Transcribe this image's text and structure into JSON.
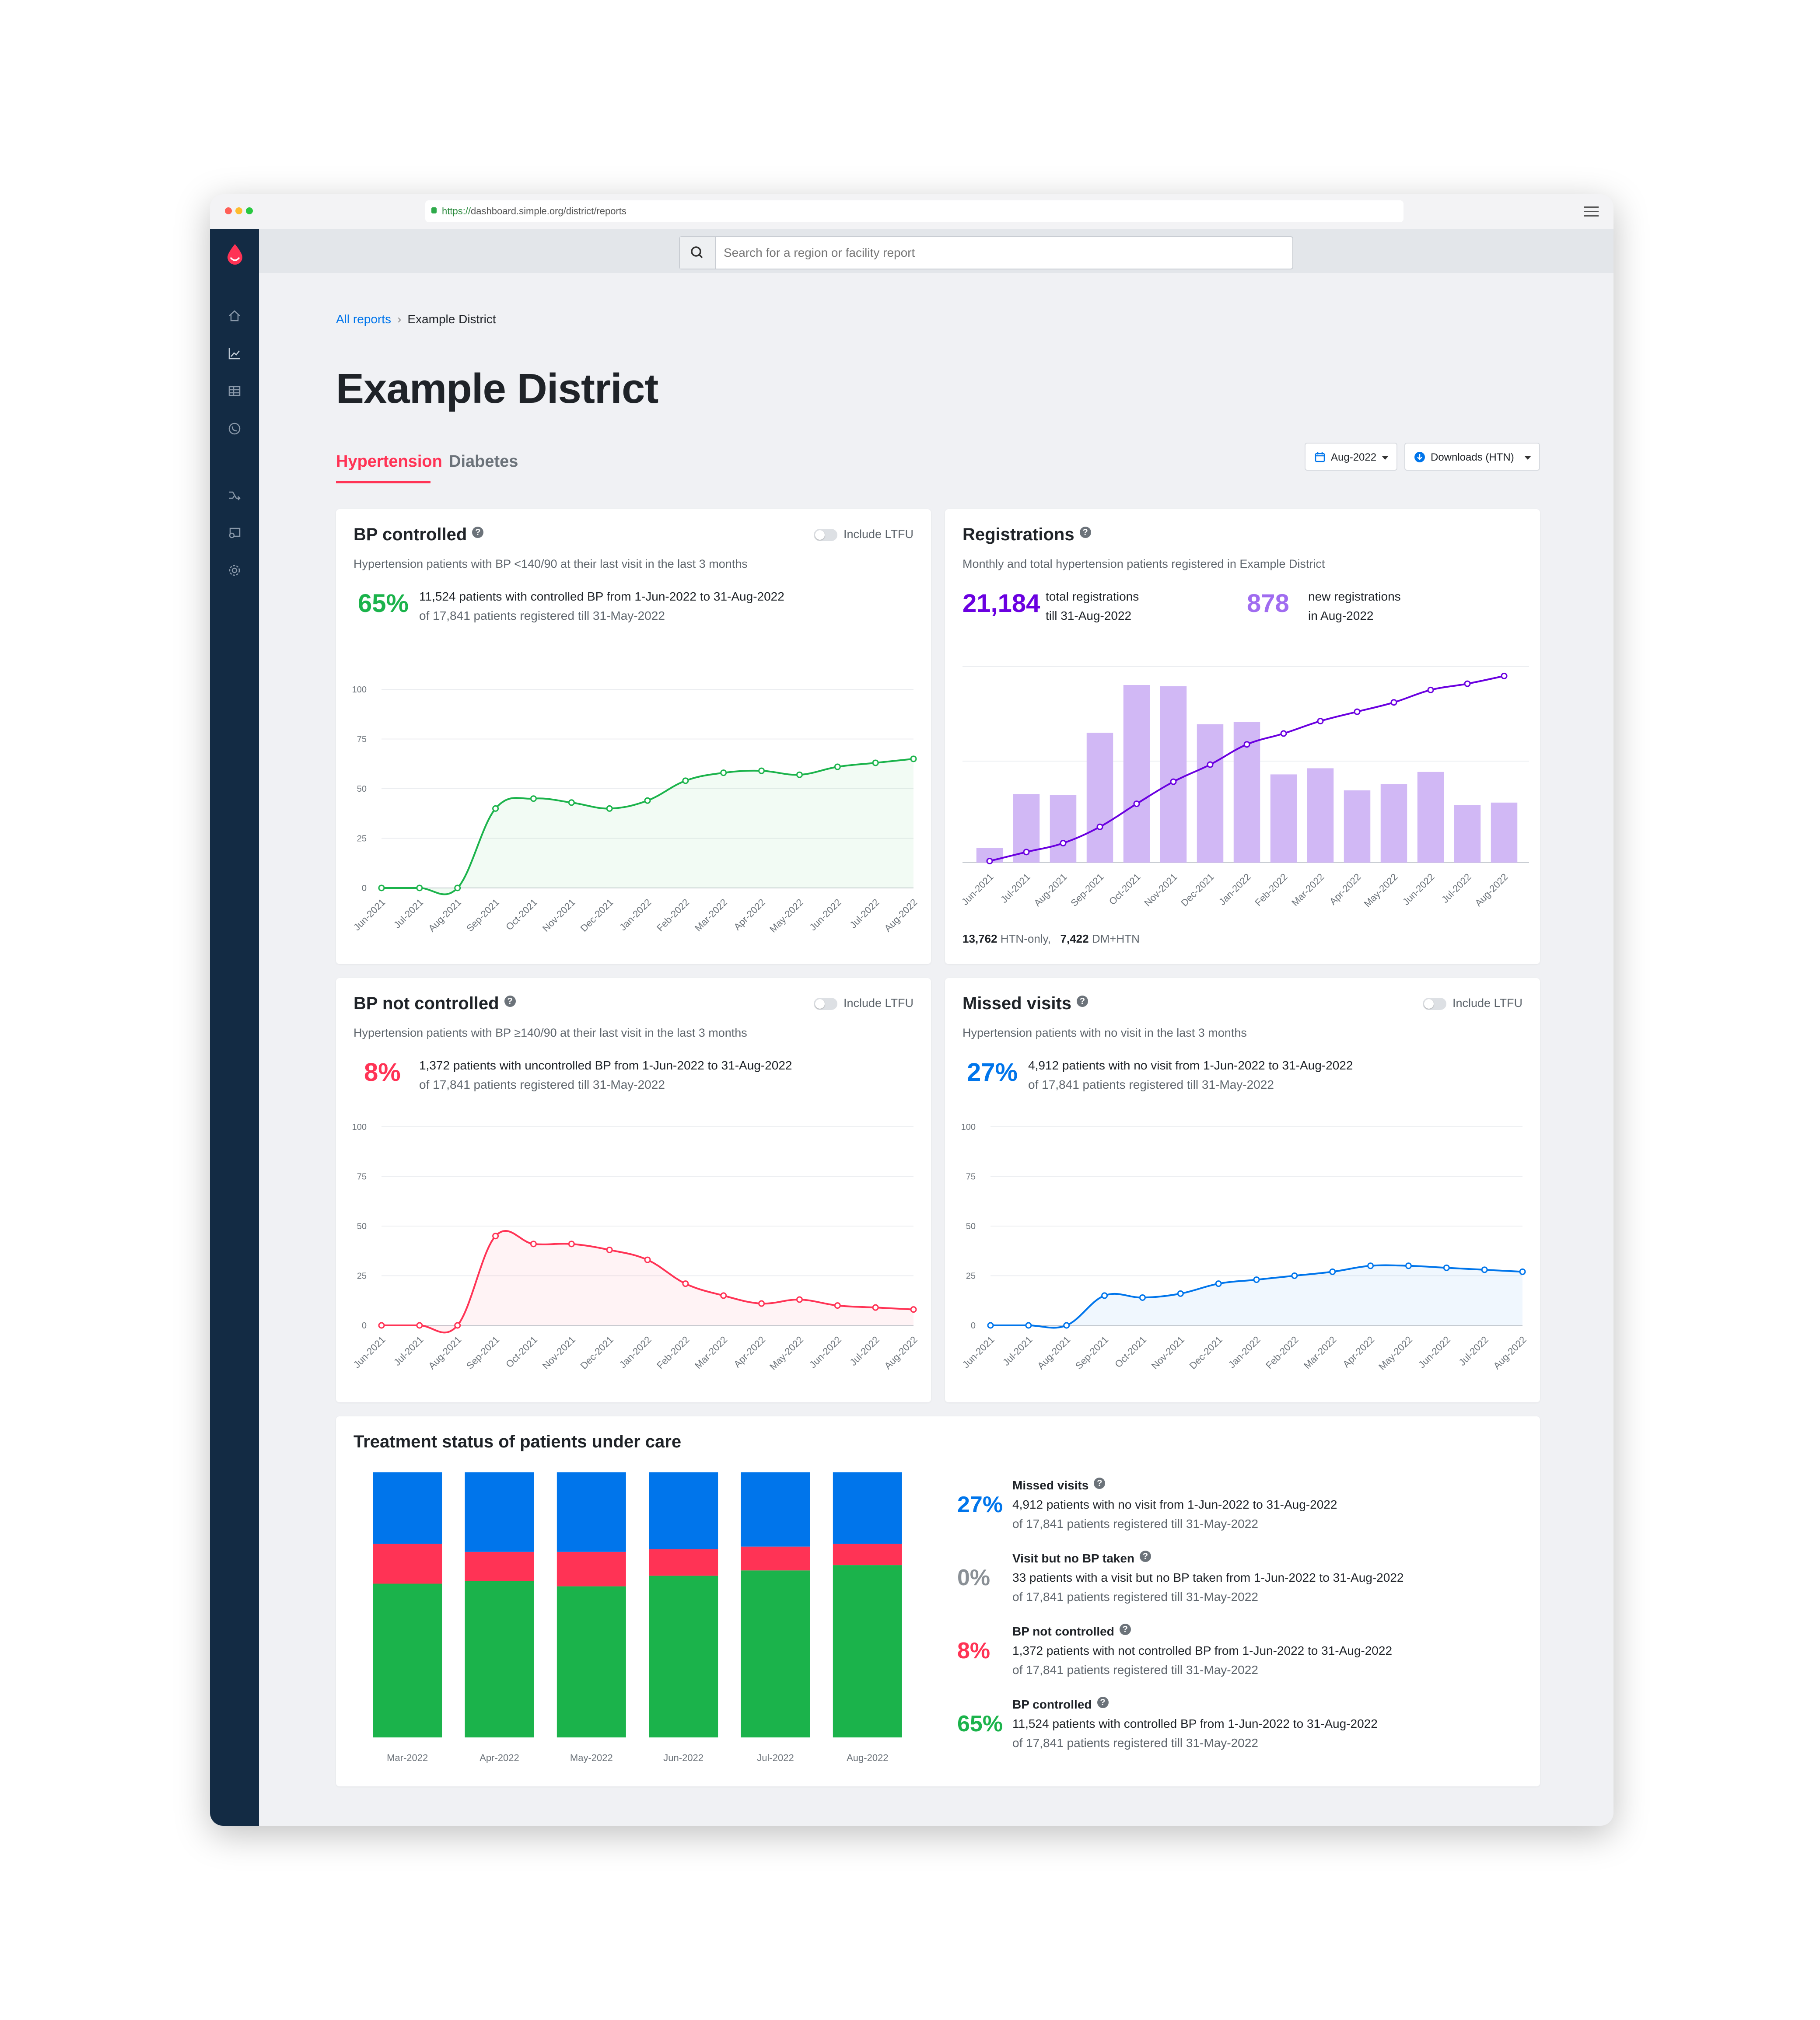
{
  "browser": {
    "url_scheme": "https://",
    "url_host": "dashboard.simple.org",
    "url_path": "/district/reports"
  },
  "search": {
    "placeholder": "Search for a region or facility report"
  },
  "breadcrumb": {
    "link": "All reports",
    "current": "Example District"
  },
  "page_title": "Example District",
  "tabs": [
    {
      "label": "Hypertension",
      "active": true
    },
    {
      "label": "Diabetes",
      "active": false
    }
  ],
  "controls": {
    "period": "Aug-2022",
    "downloads": "Downloads (HTN)"
  },
  "colors": {
    "green": "#1bb34b",
    "red": "#ff3355",
    "blue": "#0075eb",
    "purple_dark": "#6a00e0",
    "purple_bar": "#d1b8f5",
    "sidebar": "#132b44"
  },
  "months_15": [
    "Jun-2021",
    "Jul-2021",
    "Aug-2021",
    "Sep-2021",
    "Oct-2021",
    "Nov-2021",
    "Dec-2021",
    "Jan-2022",
    "Feb-2022",
    "Mar-2022",
    "Apr-2022",
    "May-2022",
    "Jun-2022",
    "Jul-2022",
    "Aug-2022"
  ],
  "bp_controlled": {
    "title": "BP controlled",
    "subtitle": "Hypertension patients with BP <140/90 at their last visit in the last 3 months",
    "ltfu_label": "Include LTFU",
    "percent": "65%",
    "line1": "11,524 patients with controlled BP from 1-Jun-2022 to 31-Aug-2022",
    "line2": "of 17,841 patients registered till 31-May-2022"
  },
  "registrations": {
    "title": "Registrations",
    "subtitle": "Monthly and total hypertension patients registered in Example District",
    "total": "21,184",
    "total_label1": "total registrations",
    "total_label2": "till 31-Aug-2022",
    "new": "878",
    "new_label1": "new registrations",
    "new_label2": "in Aug-2022",
    "footer_a_num": "13,762",
    "footer_a_label": "HTN-only,",
    "footer_b_num": "7,422",
    "footer_b_label": "DM+HTN"
  },
  "bp_not_controlled": {
    "title": "BP not controlled",
    "subtitle": "Hypertension patients with BP ≥140/90 at their last visit in the last 3 months",
    "ltfu_label": "Include LTFU",
    "percent": "8%",
    "line1": "1,372 patients with uncontrolled BP from 1-Jun-2022 to 31-Aug-2022",
    "line2": "of 17,841 patients registered till 31-May-2022"
  },
  "missed_visits": {
    "title": "Missed visits",
    "subtitle": "Hypertension patients with no visit in the last 3 months",
    "ltfu_label": "Include LTFU",
    "percent": "27%",
    "line1": "4,912 patients with no visit from 1-Jun-2022 to 31-Aug-2022",
    "line2": "of 17,841 patients registered till 31-May-2022"
  },
  "treatment": {
    "title": "Treatment status of patients under care",
    "items": [
      {
        "title": "Missed visits",
        "percent": "27%",
        "line1": "4,912 patients with no visit from 1-Jun-2022 to 31-Aug-2022",
        "line2": "of 17,841 patients registered till 31-May-2022"
      },
      {
        "title": "Visit but no BP taken",
        "percent": "0%",
        "line1": "33 patients with a visit but no BP taken from 1-Jun-2022 to 31-Aug-2022",
        "line2": "of 17,841 patients registered till 31-May-2022"
      },
      {
        "title": "BP not controlled",
        "percent": "8%",
        "line1": "1,372 patients with not controlled BP from 1-Jun-2022 to 31-Aug-2022",
        "line2": "of 17,841 patients registered till 31-May-2022"
      },
      {
        "title": "BP controlled",
        "percent": "65%",
        "line1": "11,524 patients with controlled BP from 1-Jun-2022 to 31-Aug-2022",
        "line2": "of 17,841 patients registered till 31-May-2022"
      }
    ]
  },
  "chart_data": [
    {
      "id": "bp_controlled",
      "type": "area",
      "x": [
        "Jun-2021",
        "Jul-2021",
        "Aug-2021",
        "Sep-2021",
        "Oct-2021",
        "Nov-2021",
        "Dec-2021",
        "Jan-2022",
        "Feb-2022",
        "Mar-2022",
        "Apr-2022",
        "May-2022",
        "Jun-2022",
        "Jul-2022",
        "Aug-2022"
      ],
      "y": [
        0,
        0,
        0,
        40,
        45,
        43,
        40,
        44,
        54,
        58,
        59,
        57,
        61,
        63,
        65
      ],
      "yticks": [
        0,
        25,
        50,
        75,
        100
      ],
      "ylim": [
        0,
        100
      ],
      "color": "#1bb34b"
    },
    {
      "id": "registrations",
      "type": "bar",
      "categories": [
        "Jun-2021",
        "Jul-2021",
        "Aug-2021",
        "Sep-2021",
        "Oct-2021",
        "Nov-2021",
        "Dec-2021",
        "Jan-2022",
        "Feb-2022",
        "Mar-2022",
        "Apr-2022",
        "May-2022",
        "Jun-2022",
        "Jul-2022",
        "Aug-2022"
      ],
      "values": [
        120,
        560,
        550,
        1060,
        1450,
        1440,
        1130,
        1150,
        720,
        770,
        590,
        640,
        740,
        470,
        490
      ],
      "cumulative": [
        100,
        680,
        1250,
        2300,
        3780,
        5200,
        6300,
        7600,
        8300,
        9100,
        9700,
        10300,
        11100,
        11500,
        12000
      ],
      "color": "#d1b8f5",
      "line_color": "#6a00e0"
    },
    {
      "id": "bp_not_controlled",
      "type": "area",
      "x": [
        "Jun-2021",
        "Jul-2021",
        "Aug-2021",
        "Sep-2021",
        "Oct-2021",
        "Nov-2021",
        "Dec-2021",
        "Jan-2022",
        "Feb-2022",
        "Mar-2022",
        "Apr-2022",
        "May-2022",
        "Jun-2022",
        "Jul-2022",
        "Aug-2022"
      ],
      "y": [
        0,
        0,
        0,
        45,
        41,
        41,
        38,
        33,
        21,
        15,
        11,
        13,
        10,
        9,
        8
      ],
      "yticks": [
        0,
        25,
        50,
        75,
        100
      ],
      "ylim": [
        0,
        100
      ],
      "color": "#ff3355"
    },
    {
      "id": "missed_visits",
      "type": "area",
      "x": [
        "Jun-2021",
        "Jul-2021",
        "Aug-2021",
        "Sep-2021",
        "Oct-2021",
        "Nov-2021",
        "Dec-2021",
        "Jan-2022",
        "Feb-2022",
        "Mar-2022",
        "Apr-2022",
        "May-2022",
        "Jun-2022",
        "Jul-2022",
        "Aug-2022"
      ],
      "y": [
        0,
        0,
        0,
        15,
        14,
        16,
        21,
        23,
        25,
        27,
        30,
        30,
        29,
        28,
        27
      ],
      "yticks": [
        0,
        25,
        50,
        75,
        100
      ],
      "ylim": [
        0,
        100
      ],
      "color": "#0075eb"
    },
    {
      "id": "treatment_status",
      "type": "bar",
      "stacked": true,
      "categories": [
        "Mar-2022",
        "Apr-2022",
        "May-2022",
        "Jun-2022",
        "Jul-2022",
        "Aug-2022"
      ],
      "series": [
        {
          "name": "BP controlled",
          "values": [
            58,
            59,
            57,
            61,
            63,
            65
          ],
          "color": "#1bb34b"
        },
        {
          "name": "BP not controlled",
          "values": [
            15,
            11,
            13,
            10,
            9,
            8
          ],
          "color": "#ff3355"
        },
        {
          "name": "Visit but no BP taken",
          "values": [
            0,
            0,
            0,
            0,
            0,
            0
          ],
          "color": "#ffc400"
        },
        {
          "name": "Missed visits",
          "values": [
            27,
            30,
            30,
            29,
            28,
            27
          ],
          "color": "#0075eb"
        }
      ],
      "ylim": [
        0,
        100
      ]
    }
  ]
}
